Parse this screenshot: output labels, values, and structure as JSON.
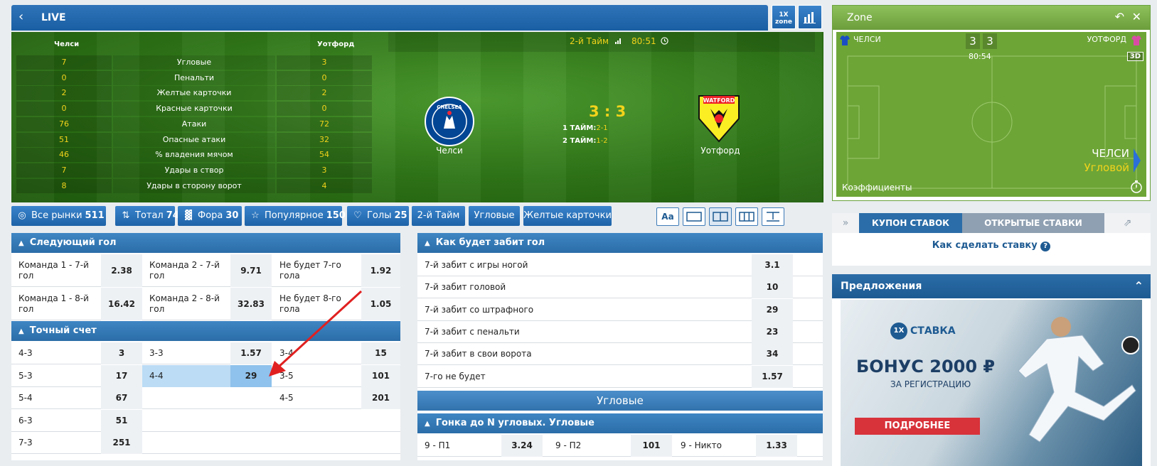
{
  "header": {
    "title": "LIVE",
    "zone_btn": "1X zone"
  },
  "board": {
    "home": "Челси",
    "away": "Уотфорд",
    "period": "2-й Тайм",
    "time": "80:51",
    "score": "3 : 3",
    "half1_label": "1 ТАЙМ:",
    "half1_score": "2-1",
    "half2_label": "2 ТАЙМ:",
    "half2_score": "1-2",
    "home_crest_text": "CHELSEA",
    "away_crest_text": "WATFORD",
    "stats": [
      {
        "home": "7",
        "name": "Угловые",
        "away": "3"
      },
      {
        "home": "0",
        "name": "Пенальти",
        "away": "0"
      },
      {
        "home": "2",
        "name": "Желтые карточки",
        "away": "2"
      },
      {
        "home": "0",
        "name": "Красные карточки",
        "away": "0"
      },
      {
        "home": "76",
        "name": "Атаки",
        "away": "72"
      },
      {
        "home": "51",
        "name": "Опасные атаки",
        "away": "32"
      },
      {
        "home": "46",
        "name": "% владения мячом",
        "away": "54"
      },
      {
        "home": "7",
        "name": "Удары в створ",
        "away": "3"
      },
      {
        "home": "8",
        "name": "Удары в сторону ворот",
        "away": "4"
      }
    ]
  },
  "tabs": [
    {
      "label": "Все рынки",
      "count": "511",
      "icon": "target-icon"
    },
    {
      "label": "Тотал",
      "count": "74",
      "icon": "updown-icon"
    },
    {
      "label": "Фора",
      "count": "30",
      "icon": "chart-icon"
    },
    {
      "label": "Популярное",
      "count": "150",
      "icon": "star-icon"
    },
    {
      "label": "Голы",
      "count": "25",
      "icon": "goals-icon"
    },
    {
      "label": "2-й Тайм",
      "count": ""
    },
    {
      "label": "Угловые",
      "count": ""
    },
    {
      "label": "Желтые карточки",
      "count": ""
    }
  ],
  "view_buttons": [
    "font-size-icon",
    "layout-1col-icon",
    "layout-2col-icon",
    "layout-3col-icon",
    "layout-table-icon"
  ],
  "font_btn": "Aa",
  "next_goal": {
    "title": "Следующий гол",
    "rows": [
      [
        {
          "label": "Команда 1 - 7-й гол",
          "odd": "2.38"
        },
        {
          "label": "Команда 2 - 7-й гол",
          "odd": "9.71"
        },
        {
          "label": "Не будет 7-го гола",
          "odd": "1.92"
        }
      ],
      [
        {
          "label": "Команда 1 - 8-й гол",
          "odd": "16.42"
        },
        {
          "label": "Команда 2 - 8-й гол",
          "odd": "32.83"
        },
        {
          "label": "Не будет 8-го гола",
          "odd": "1.05"
        }
      ]
    ]
  },
  "exact_score": {
    "title": "Точный счет",
    "rows": [
      [
        {
          "label": "4-3",
          "odd": "3"
        },
        {
          "label": "3-3",
          "odd": "1.57"
        },
        {
          "label": "3-4",
          "odd": "15"
        }
      ],
      [
        {
          "label": "5-3",
          "odd": "17"
        },
        {
          "label": "4-4",
          "odd": "29"
        },
        {
          "label": "3-5",
          "odd": "101"
        }
      ],
      [
        {
          "label": "5-4",
          "odd": "67"
        },
        {
          "label": "",
          "odd": ""
        },
        {
          "label": "4-5",
          "odd": "201"
        }
      ],
      [
        {
          "label": "6-3",
          "odd": "51"
        },
        {
          "label": "",
          "odd": ""
        },
        {
          "label": "",
          "odd": ""
        }
      ],
      [
        {
          "label": "7-3",
          "odd": "251"
        },
        {
          "label": "",
          "odd": ""
        },
        {
          "label": "",
          "odd": ""
        }
      ]
    ]
  },
  "how_scored": {
    "title": "Как будет забит гол",
    "rows": [
      {
        "label": "7-й забит с игры ногой",
        "odd": "3.1"
      },
      {
        "label": "7-й забит головой",
        "odd": "10"
      },
      {
        "label": "7-й забит со штрафного",
        "odd": "29"
      },
      {
        "label": "7-й забит с пенальти",
        "odd": "23"
      },
      {
        "label": "7-й забит в свои ворота",
        "odd": "34"
      },
      {
        "label": "7-го не будет",
        "odd": "1.57"
      }
    ]
  },
  "corners_sep": "Угловые",
  "corner_race": {
    "title": "Гонка до N угловых. Угловые",
    "row": [
      {
        "label": "9 - П1",
        "odd": "3.24"
      },
      {
        "label": "9 - П2",
        "odd": "101"
      },
      {
        "label": "9 - Никто",
        "odd": "1.33"
      }
    ]
  },
  "zone": {
    "title": "Zone",
    "home": "ЧЕЛСИ",
    "away": "УОТФОРД",
    "home_score": "3",
    "away_score": "3",
    "time": "80:54",
    "mode": "3D",
    "event_team": "ЧЕЛСИ",
    "event_type": "Угловой",
    "odds_label": "Коэффициенты"
  },
  "coupon": {
    "tab1": "КУПОН СТАВОК",
    "tab2": "ОТКРЫТЫЕ СТАВКИ",
    "help": "Как сделать ставку"
  },
  "offers": {
    "title": "Предложения",
    "brand": "СТАВКА",
    "brand_logo": "1X",
    "bonus": "БОНУС 2000 ₽",
    "subtitle": "ЗА РЕГИСТРАЦИЮ",
    "cta": "ПОДРОБНЕЕ"
  },
  "colors": {
    "accent": "#2b6da8",
    "highlight": "#bcdcf5",
    "score_yellow": "#f2d31b",
    "zone_green": "#6da537"
  }
}
